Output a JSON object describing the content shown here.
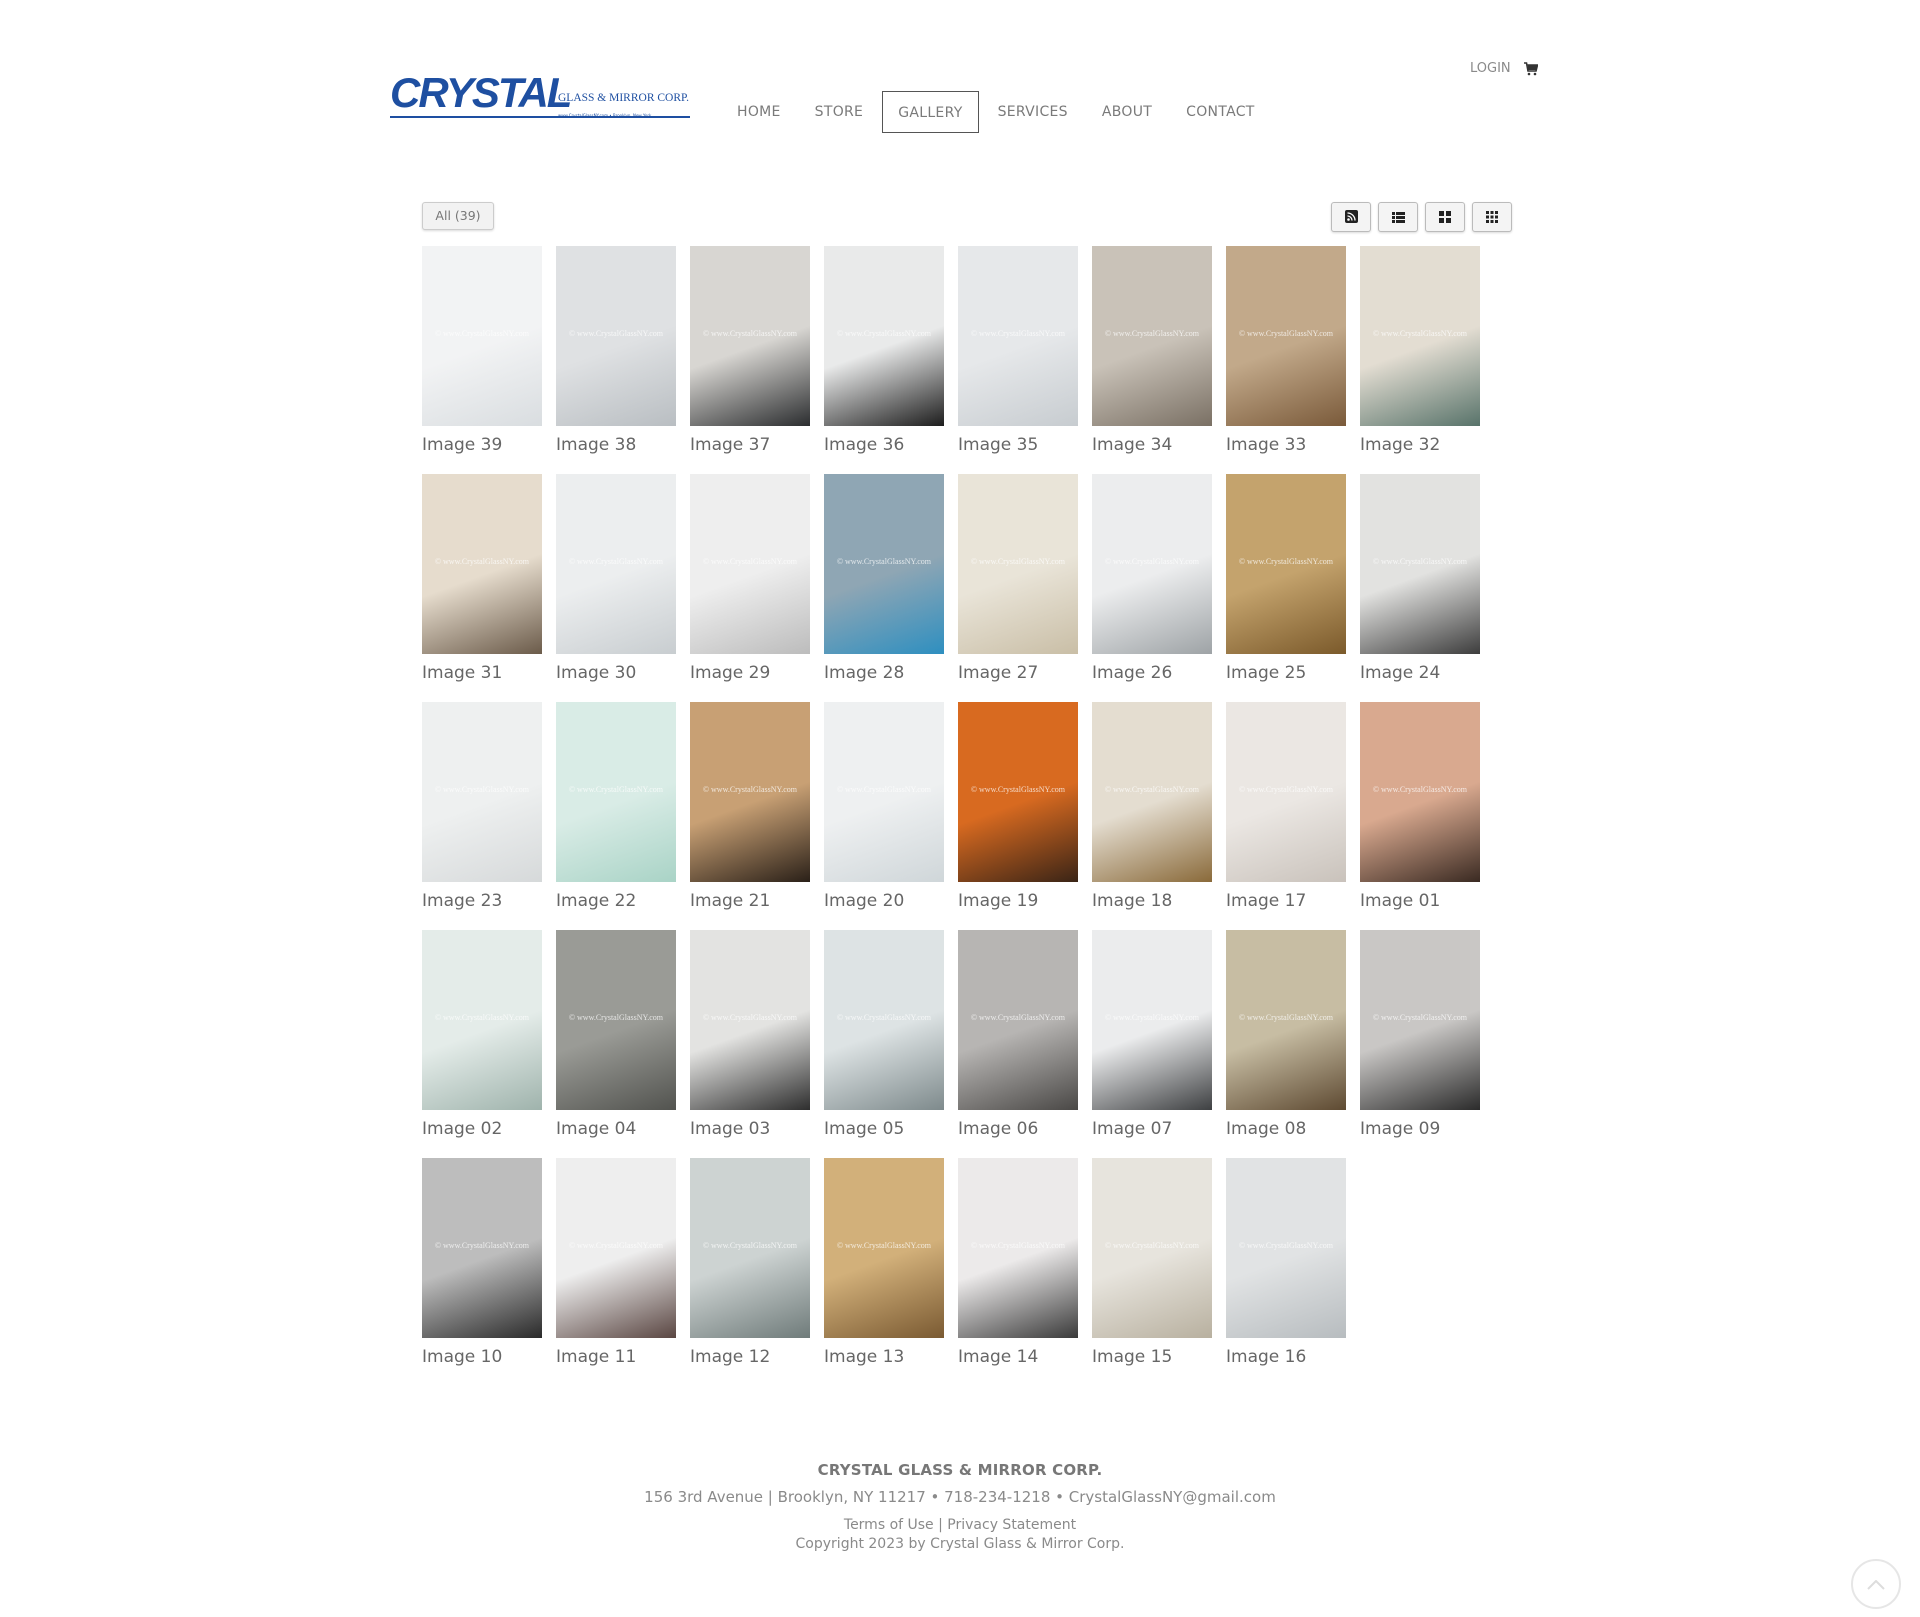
{
  "logo": {
    "word": "CRYSTAL",
    "sub": "GLASS & MIRROR CORP.",
    "tagline": "www.CrystalGlassNY.com  •  Brooklyn, New York"
  },
  "nav": [
    {
      "label": "HOME",
      "active": false
    },
    {
      "label": "STORE",
      "active": false
    },
    {
      "label": "GALLERY",
      "active": true
    },
    {
      "label": "SERVICES",
      "active": false
    },
    {
      "label": "ABOUT",
      "active": false
    },
    {
      "label": "CONTACT",
      "active": false
    }
  ],
  "login_label": "LOGIN",
  "filter_label": "All (39)",
  "view_buttons": [
    "rss-icon",
    "list-view-icon",
    "large-grid-icon",
    "small-grid-icon"
  ],
  "watermark": "© www.CrystalGlassNY.com",
  "gallery": [
    {
      "title": "Image 39",
      "colors": [
        "#f2f3f4",
        "#d9dde0"
      ]
    },
    {
      "title": "Image 38",
      "colors": [
        "#dfe1e3",
        "#b9bec2"
      ]
    },
    {
      "title": "Image 37",
      "colors": [
        "#d8d6d2",
        "#2b2d2f"
      ]
    },
    {
      "title": "Image 36",
      "colors": [
        "#e9eaea",
        "#1d1d1d"
      ]
    },
    {
      "title": "Image 35",
      "colors": [
        "#e6e8ea",
        "#c7ccd0"
      ]
    },
    {
      "title": "Image 34",
      "colors": [
        "#c9c2b8",
        "#7a7064"
      ]
    },
    {
      "title": "Image 33",
      "colors": [
        "#c2a98a",
        "#7a5a3a"
      ]
    },
    {
      "title": "Image 32",
      "colors": [
        "#e3ddd2",
        "#58736a"
      ]
    },
    {
      "title": "Image 31",
      "colors": [
        "#e6dccd",
        "#6b5b4a"
      ]
    },
    {
      "title": "Image 30",
      "colors": [
        "#eceeef",
        "#c8cdd0"
      ]
    },
    {
      "title": "Image 29",
      "colors": [
        "#eeeeee",
        "#bcbcbc"
      ]
    },
    {
      "title": "Image 28",
      "colors": [
        "#8fa6b4",
        "#2e8fc0"
      ]
    },
    {
      "title": "Image 27",
      "colors": [
        "#e9e4d8",
        "#c9bea6"
      ]
    },
    {
      "title": "Image 26",
      "colors": [
        "#ecedee",
        "#9ea3a6"
      ]
    },
    {
      "title": "Image 25",
      "colors": [
        "#c4a36d",
        "#7b5a2b"
      ]
    },
    {
      "title": "Image 24",
      "colors": [
        "#e2e2e0",
        "#3d3d3d"
      ]
    },
    {
      "title": "Image 23",
      "colors": [
        "#eef0f0",
        "#d6d9da"
      ]
    },
    {
      "title": "Image 22",
      "colors": [
        "#d9ece6",
        "#a9d3c6"
      ]
    },
    {
      "title": "Image 21",
      "colors": [
        "#c8a074",
        "#2a2018"
      ]
    },
    {
      "title": "Image 20",
      "colors": [
        "#eef0f1",
        "#cfd6d9"
      ]
    },
    {
      "title": "Image 19",
      "colors": [
        "#d86a20",
        "#3a2416"
      ]
    },
    {
      "title": "Image 18",
      "colors": [
        "#e4ddd0",
        "#8a6a3a"
      ]
    },
    {
      "title": "Image 17",
      "colors": [
        "#ebe7e3",
        "#c9c2bb"
      ]
    },
    {
      "title": "Image 01",
      "colors": [
        "#d9a98f",
        "#3a2a22"
      ]
    },
    {
      "title": "Image 02",
      "colors": [
        "#e4ece9",
        "#9fb3ac"
      ]
    },
    {
      "title": "Image 04",
      "colors": [
        "#9a9b96",
        "#52534f"
      ]
    },
    {
      "title": "Image 03",
      "colors": [
        "#e3e3e1",
        "#2e2e2e"
      ]
    },
    {
      "title": "Image 05",
      "colors": [
        "#dde3e4",
        "#7e8a8c"
      ]
    },
    {
      "title": "Image 06",
      "colors": [
        "#b7b5b3",
        "#4a4846"
      ]
    },
    {
      "title": "Image 07",
      "colors": [
        "#ebeced",
        "#3e4042"
      ]
    },
    {
      "title": "Image 08",
      "colors": [
        "#c7bda3",
        "#5e4a32"
      ]
    },
    {
      "title": "Image 09",
      "colors": [
        "#c9c7c5",
        "#2b2b2b"
      ]
    },
    {
      "title": "Image 10",
      "colors": [
        "#bdbdbd",
        "#2a2a2a"
      ]
    },
    {
      "title": "Image 11",
      "colors": [
        "#eeeeee",
        "#5a4642"
      ]
    },
    {
      "title": "Image 12",
      "colors": [
        "#cdd3d2",
        "#6f7b7a"
      ]
    },
    {
      "title": "Image 13",
      "colors": [
        "#d2b07a",
        "#7a5a32"
      ]
    },
    {
      "title": "Image 14",
      "colors": [
        "#eceaea",
        "#3a3a3a"
      ]
    },
    {
      "title": "Image 15",
      "colors": [
        "#e7e4dd",
        "#b8b09f"
      ]
    },
    {
      "title": "Image 16",
      "colors": [
        "#e1e3e4",
        "#b7bcbf"
      ]
    }
  ],
  "footer": {
    "company": "CRYSTAL GLASS & MIRROR CORP.",
    "address": "156 3rd Avenue | Brooklyn, NY 11217 • 718-234-1218 • CrystalGlassNY@gmail.com",
    "terms": "Terms of Use",
    "separator": "|",
    "privacy": "Privacy Statement",
    "copyright": "Copyright 2023 by Crystal Glass & Mirror Corp."
  }
}
